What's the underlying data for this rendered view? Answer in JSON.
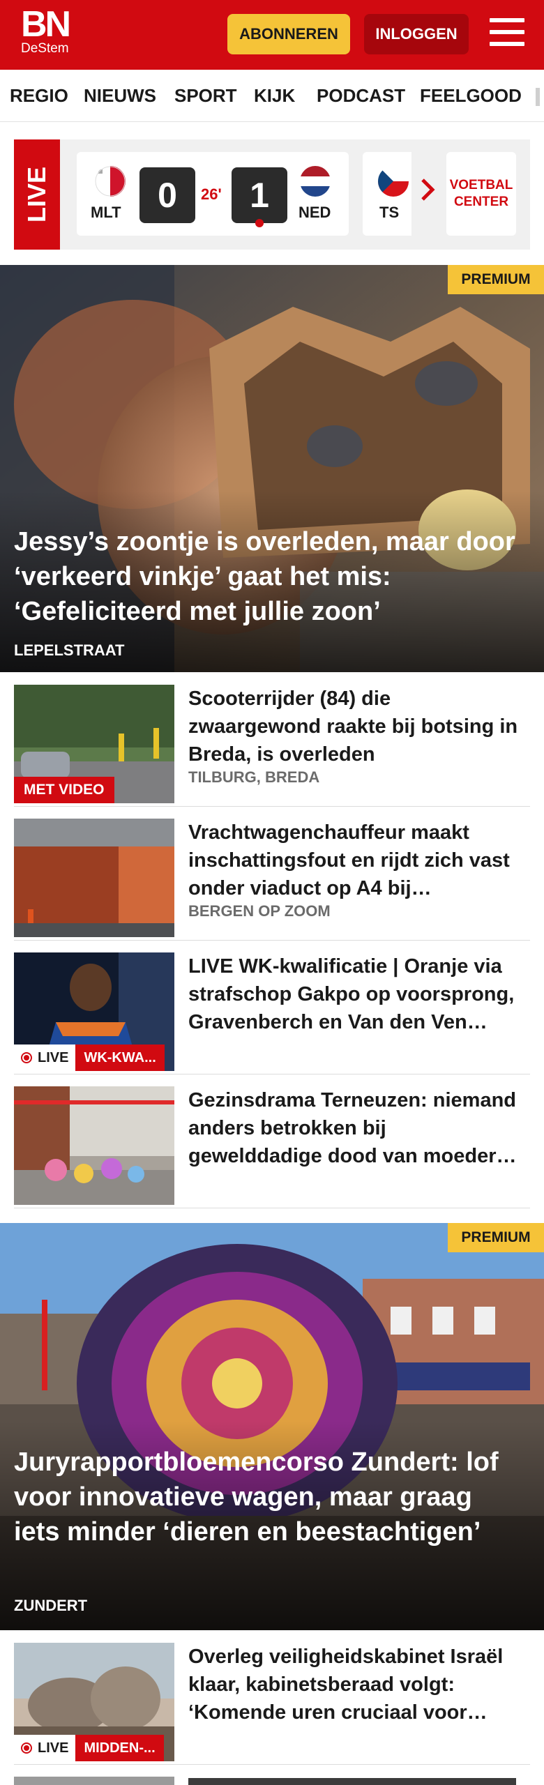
{
  "header": {
    "logo_main": "BN",
    "logo_sub": "DeStem",
    "subscribe_label": "ABONNEREN",
    "login_label": "INLOGGEN",
    "menu_icon": "hamburger-icon",
    "brand_color": "#d10a11",
    "accent_color": "#f5c338"
  },
  "nav": {
    "items": [
      "REGIO",
      "NIEUWS",
      "SPORT",
      "KIJK",
      "PODCAST",
      "FEELGOOD"
    ]
  },
  "live": {
    "label": "LIVE",
    "match": {
      "home_team": "MLT",
      "home_score": "0",
      "minute": "26'",
      "away_score": "1",
      "away_team": "NED"
    },
    "next_match_team": "TS",
    "voetbal_center": "VOETBAL CENTER"
  },
  "hero1": {
    "badge": "PREMIUM",
    "title": "Jessy’s zoontje is overleden, maar door ‘verkeerd vinkje’ gaat het mis: ‘Gefeliciteerd met jullie zoon’",
    "location": "LEPELSTRAAT"
  },
  "articles1": [
    {
      "title": "Scooterrijder (84) die zwaargewond raakte bij botsing in Breda, is overleden",
      "location": "TILBURG, BREDA",
      "badge": "MET VIDEO"
    },
    {
      "title": "Vrachtwagenchauffeur maakt inschattingsfout en rijdt zich vast onder viaduct op A4 bij…",
      "location": "BERGEN OP ZOOM"
    },
    {
      "title": "LIVE WK-kwalificatie | Oranje via strafschop Gakpo op voorsprong, Gravenberch en Van den Ven…",
      "live_label": "LIVE",
      "tag": "WK-KWA..."
    },
    {
      "title": "Gezinsdrama Terneuzen: niemand anders betrokken bij gewelddadige dood van moeder…"
    }
  ],
  "hero2": {
    "badge": "PREMIUM",
    "title": "Juryrapportbloemencorso Zundert: lof voor innovatieve wagen, maar graag iets minder ‘dieren en beestachtigen’",
    "location": "ZUNDERT"
  },
  "articles2": [
    {
      "title": "Overleg veiligheidskabinet Israël klaar, kabinetsberaad volgt: ‘Komende uren cruciaal voor…",
      "live_label": "LIVE",
      "tag": "MIDDEN-..."
    }
  ]
}
